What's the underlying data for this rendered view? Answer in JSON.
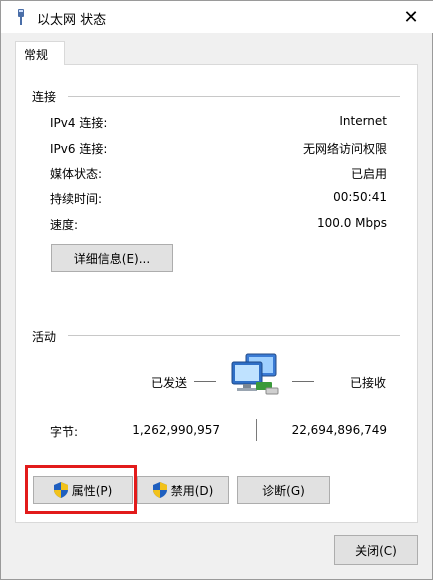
{
  "window": {
    "title": "以太网 状态",
    "close_glyph": "✕",
    "tab_label": "常规"
  },
  "connection": {
    "group_label": "连接",
    "rows": [
      {
        "label": "IPv4 连接:",
        "value": "Internet"
      },
      {
        "label": "IPv6 连接:",
        "value": "无网络访问权限"
      },
      {
        "label": "媒体状态:",
        "value": "已启用"
      },
      {
        "label": "持续时间:",
        "value": "00:50:41"
      },
      {
        "label": "速度:",
        "value": "100.0 Mbps"
      }
    ],
    "details_button": "详细信息(E)..."
  },
  "activity": {
    "group_label": "活动",
    "sent_label": "已发送",
    "received_label": "已接收",
    "bytes_label": "字节:",
    "bytes_sent": "1,262,990,957",
    "bytes_received": "22,694,896,749"
  },
  "buttons": {
    "properties": "属性(P)",
    "disable": "禁用(D)",
    "diagnose": "诊断(G)",
    "close": "关闭(C)"
  },
  "icons": {
    "title": "network-adapter-icon",
    "network": "network-computers-icon",
    "shield": "uac-shield-icon"
  },
  "colors": {
    "highlight": "#e21b1b",
    "shield_blue": "#1f5fbf",
    "shield_yellow": "#f2c21b"
  }
}
